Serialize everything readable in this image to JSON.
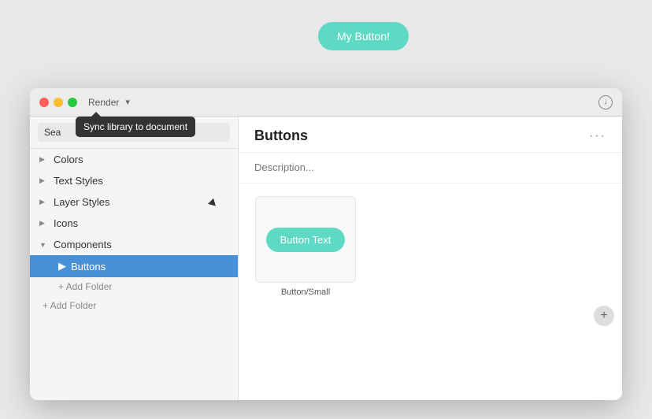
{
  "background_button": {
    "label": "My Button!"
  },
  "window": {
    "title_bar": {
      "title": "Render",
      "chevron": "▾",
      "download_icon": "⬇"
    },
    "sidebar": {
      "search_placeholder": "Sea...",
      "items": [
        {
          "id": "colors",
          "label": "Colors",
          "chevron": "▶",
          "expanded": false
        },
        {
          "id": "text-styles",
          "label": "Text Styles",
          "chevron": "▶",
          "expanded": false
        },
        {
          "id": "layer-styles",
          "label": "Layer Styles",
          "chevron": "▶",
          "expanded": false
        },
        {
          "id": "icons",
          "label": "Icons",
          "chevron": "▶",
          "expanded": false
        },
        {
          "id": "components",
          "label": "Components",
          "chevron": "▼",
          "expanded": true
        }
      ],
      "sub_items": [
        {
          "id": "buttons",
          "label": "Buttons",
          "active": true
        }
      ],
      "add_folder_sub": "+ Add Folder",
      "add_folder_root": "+ Add Folder"
    },
    "main": {
      "title": "Buttons",
      "menu_dots": "···",
      "description_placeholder": "Description...",
      "component": {
        "button_label": "Button Text",
        "caption": "Button/Small"
      }
    }
  },
  "tooltip": {
    "text": "Sync library to document"
  }
}
